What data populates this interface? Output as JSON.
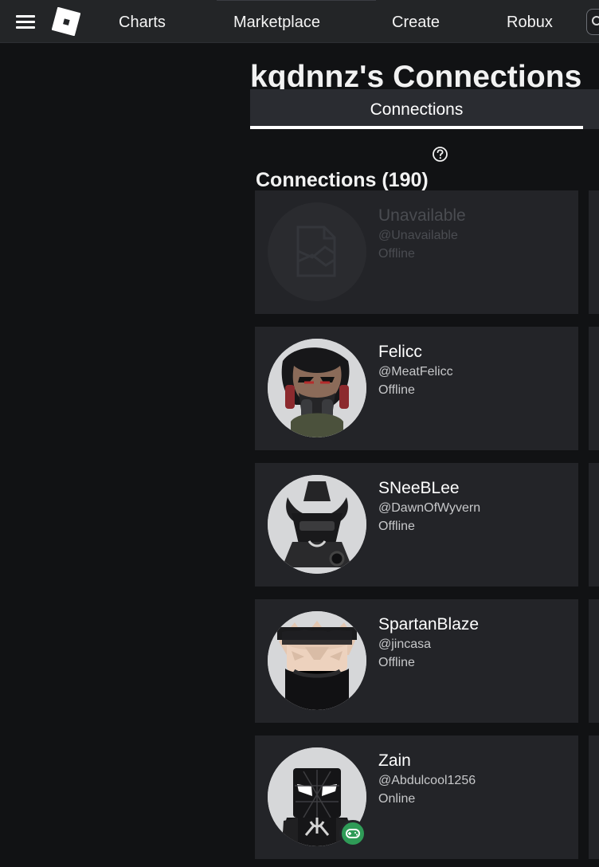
{
  "nav": {
    "menu_icon": "hamburger-menu-icon",
    "logo_icon": "roblox-logo-icon",
    "links": [
      "Charts",
      "Marketplace",
      "Create",
      "Robux"
    ],
    "search_icon": "search-icon"
  },
  "page": {
    "title": "kqdnnz's Connections",
    "tabs": [
      {
        "label": "Connections",
        "selected": true
      }
    ],
    "section_title": "Connections (190)",
    "help_icon": "help-circle-icon"
  },
  "connections": [
    {
      "name": "Unavailable",
      "username": "@Unavailable",
      "status": "Offline"
    },
    {
      "name": "Felicc",
      "username": "@MeatFelicc",
      "status": "Offline"
    },
    {
      "name": "SNeeBLee",
      "username": "@DawnOfWyvern",
      "status": "Offline"
    },
    {
      "name": "SpartanBlaze",
      "username": "@jincasa",
      "status": "Offline"
    },
    {
      "name": "Zain",
      "username": "@Abdulcool1256",
      "status": "Online"
    }
  ],
  "colors": {
    "background": "#111214",
    "topbar": "#232527",
    "card": "#232428",
    "online_badge": "#2f9b57",
    "text": "#ffffff",
    "muted_text": "#c7c8ca"
  }
}
